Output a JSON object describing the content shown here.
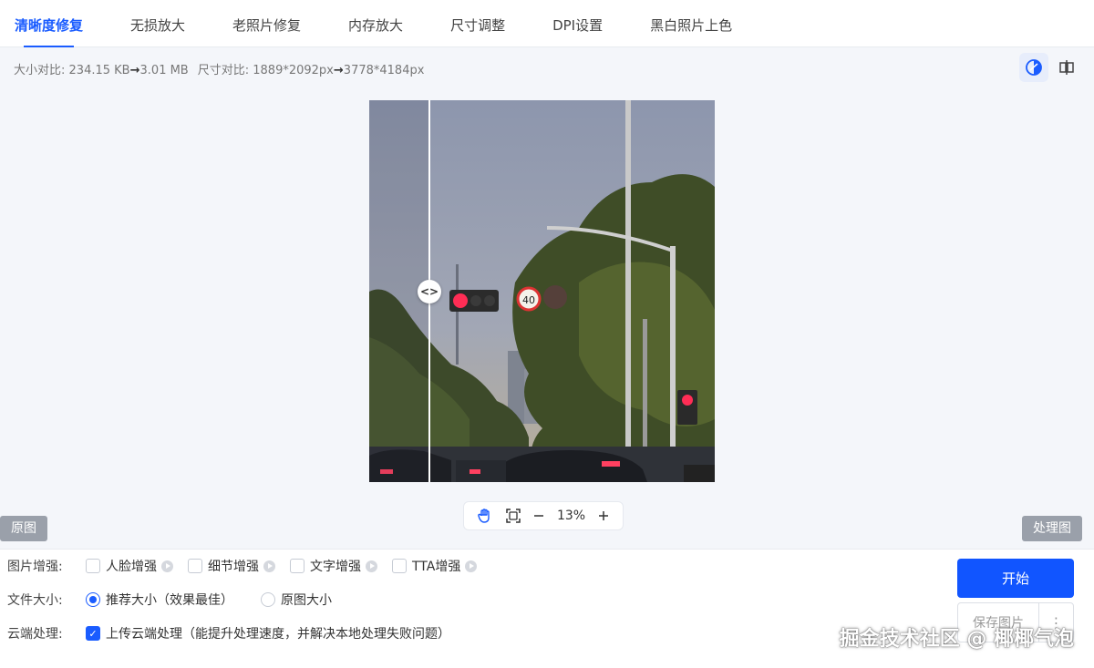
{
  "tabs": [
    {
      "label": "清晰度修复",
      "active": true
    },
    {
      "label": "无损放大"
    },
    {
      "label": "老照片修复"
    },
    {
      "label": "内存放大"
    },
    {
      "label": "尺寸调整"
    },
    {
      "label": "DPI设置"
    },
    {
      "label": "黑白照片上色"
    }
  ],
  "info": {
    "size_label": "大小对比:",
    "size_from": "234.15 KB",
    "size_to": "3.01 MB",
    "dim_label": "尺寸对比:",
    "dim_from": "1889*2092px",
    "dim_to": "3778*4184px"
  },
  "preview": {
    "original_tag": "原图",
    "processed_tag": "处理图",
    "zoom": "13%",
    "traffic_sign": "40"
  },
  "options": {
    "enhance_label": "图片增强:",
    "enhance_items": [
      "人脸增强",
      "细节增强",
      "文字增强",
      "TTA增强"
    ],
    "size_label": "文件大小:",
    "size_recommended": "推荐大小（效果最佳）",
    "size_original": "原图大小",
    "cloud_label": "云端处理:",
    "cloud_option": "上传云端处理（能提升处理速度，并解决本地处理失败问题）"
  },
  "actions": {
    "start": "开始",
    "save": "保存图片",
    "more": "⋮"
  },
  "watermark": "掘金技术社区 @ 椰椰气泡",
  "colors": {
    "accent": "#1a5cff",
    "primary_button": "#1155ff"
  }
}
